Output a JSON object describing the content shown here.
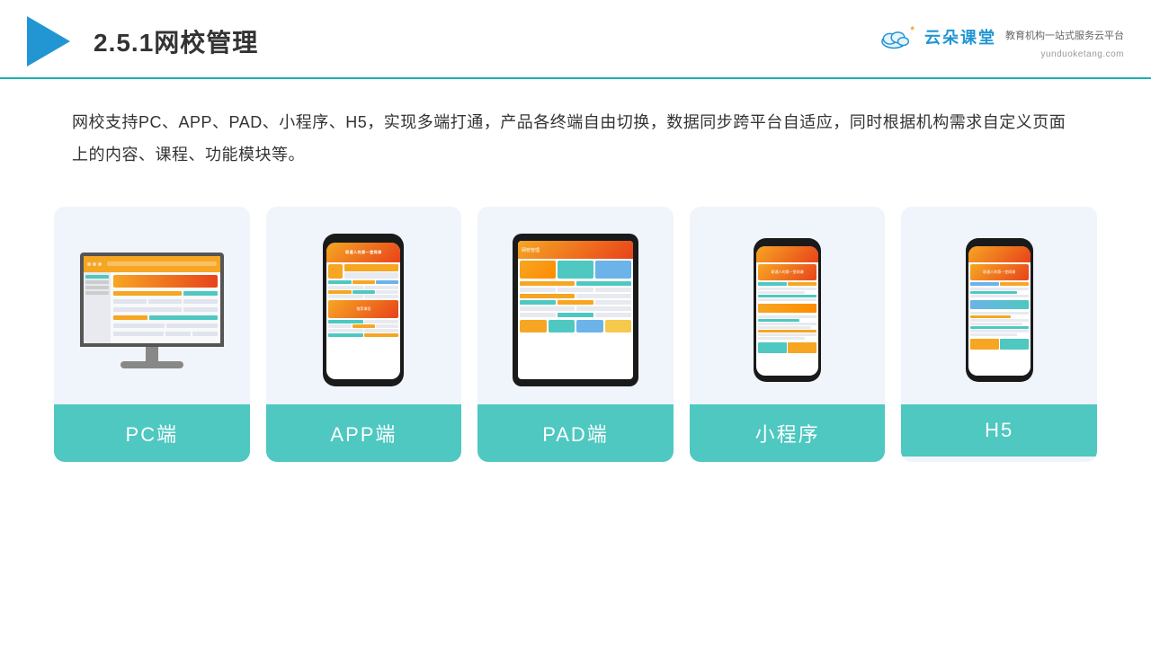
{
  "header": {
    "title": "2.5.1网校管理",
    "logo": {
      "name": "云朵课堂",
      "url": "yunduoketang.com",
      "tagline": "教育机构一站式服务云平台"
    }
  },
  "description": {
    "text": "网校支持PC、APP、PAD、小程序、H5，实现多端打通，产品各终端自由切换，数据同步跨平台自适应，同时根据机构需求自定义页面上的内容、课程、功能模块等。"
  },
  "cards": [
    {
      "id": "pc",
      "label": "PC端"
    },
    {
      "id": "app",
      "label": "APP端"
    },
    {
      "id": "pad",
      "label": "PAD端"
    },
    {
      "id": "miniprogram",
      "label": "小程序"
    },
    {
      "id": "h5",
      "label": "H5"
    }
  ]
}
